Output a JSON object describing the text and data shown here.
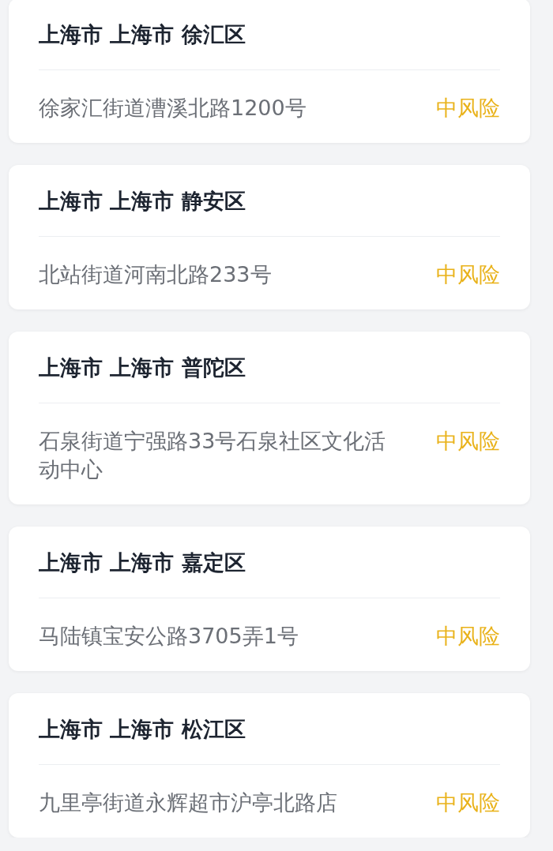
{
  "locations": [
    {
      "region": "上海市 上海市 徐汇区",
      "address": "徐家汇街道漕溪北路1200号",
      "risk": "中风险"
    },
    {
      "region": "上海市 上海市 静安区",
      "address": "北站街道河南北路233号",
      "risk": "中风险"
    },
    {
      "region": "上海市 上海市 普陀区",
      "address": "石泉街道宁强路33号石泉社区文化活动中心",
      "risk": "中风险"
    },
    {
      "region": "上海市 上海市 嘉定区",
      "address": "马陆镇宝安公路3705弄1号",
      "risk": "中风险"
    },
    {
      "region": "上海市 上海市 松江区",
      "address": "九里亭街道永辉超市沪亭北路店",
      "risk": "中风险"
    }
  ]
}
